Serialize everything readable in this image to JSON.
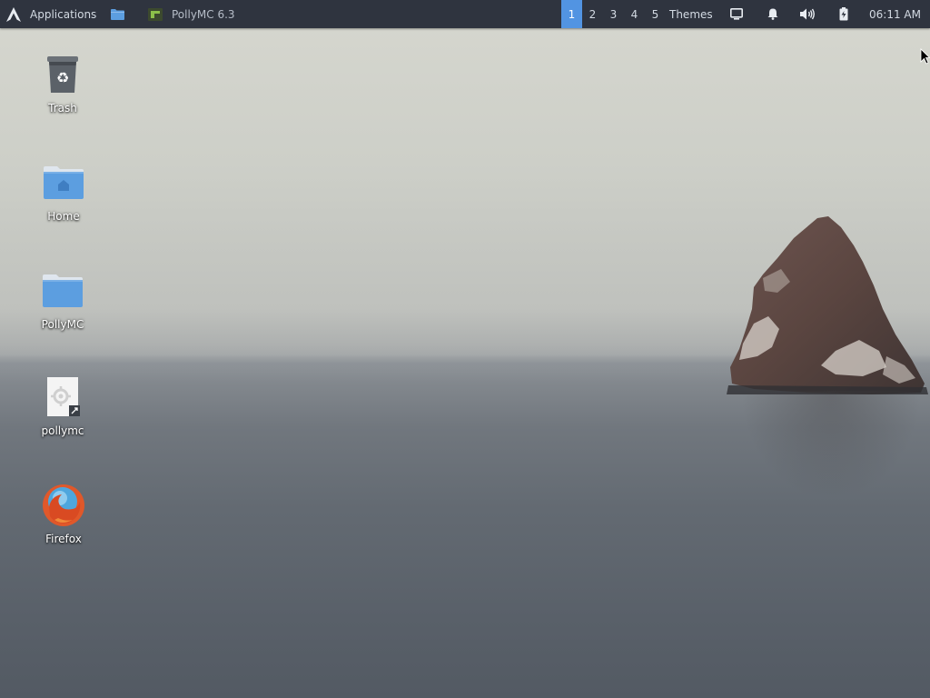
{
  "panel": {
    "app_menu_label": "Applications",
    "task_label": "PollyMC 6.3",
    "workspaces": [
      "1",
      "2",
      "3",
      "4",
      "5"
    ],
    "active_workspace": "1",
    "themes_label": "Themes",
    "clock": "06:11 AM"
  },
  "desktop": {
    "icons": [
      {
        "label": "Trash",
        "icon": "trash-icon"
      },
      {
        "label": "Home",
        "icon": "home-folder-icon"
      },
      {
        "label": "PollyMC",
        "icon": "folder-icon"
      },
      {
        "label": "pollymc",
        "icon": "executable-file-icon"
      },
      {
        "label": "Firefox",
        "icon": "firefox-icon"
      }
    ]
  },
  "colors": {
    "panel_bg": "#2f343f",
    "accent": "#5294e2",
    "folder": "#5c9ee0"
  }
}
